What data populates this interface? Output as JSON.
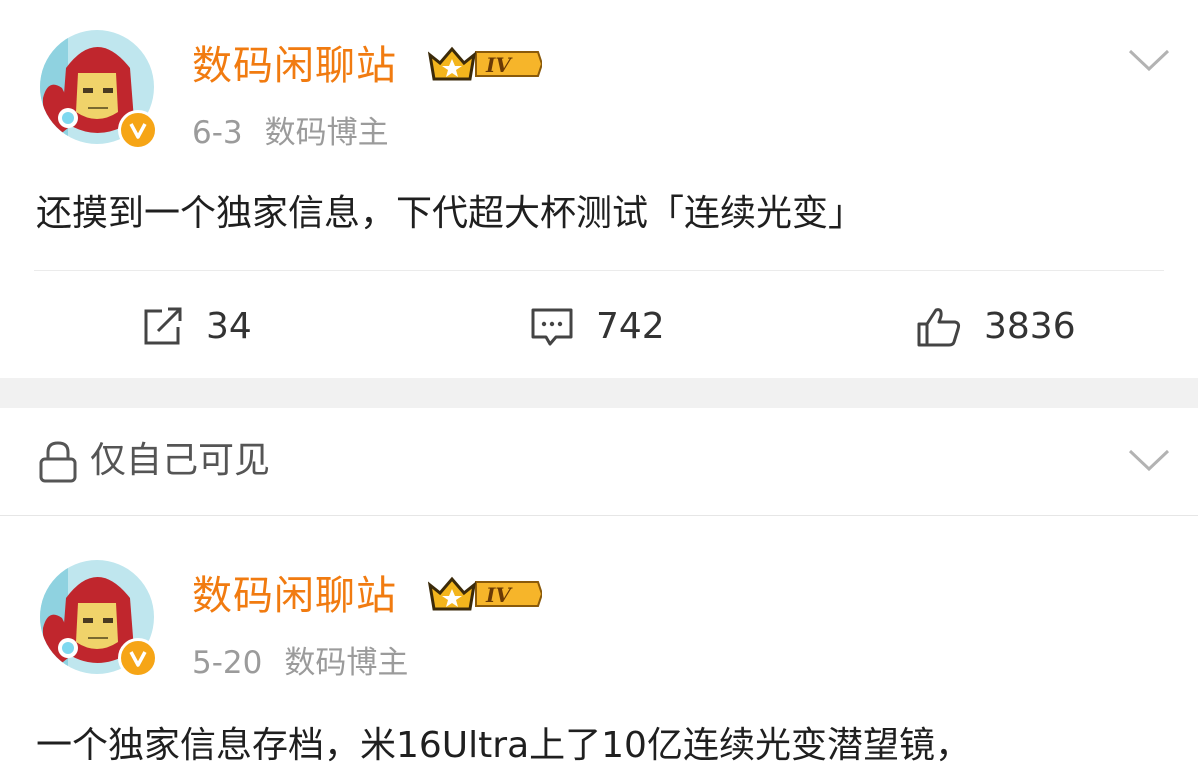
{
  "posts": [
    {
      "author": "数码闲聊站",
      "level_badge": "IV",
      "date": "6-3",
      "role": "数码博主",
      "text": "还摸到一个独家信息，下代超大杯测试「连续光变」",
      "actions": {
        "repost_count": "34",
        "comment_count": "742",
        "like_count": "3836"
      }
    },
    {
      "author": "数码闲聊站",
      "level_badge": "IV",
      "date": "5-20",
      "role": "数码博主",
      "text": "一个独家信息存档，米16Ultra上了10亿连续光变潜望镜，"
    }
  ],
  "private_item": {
    "label": "仅自己可见"
  },
  "icons": {
    "verified": "verified-v-icon",
    "crown": "crown-icon",
    "expand": "chevron-down-icon",
    "repost": "share-icon",
    "comment": "comment-icon",
    "like": "thumbs-up-icon",
    "lock": "lock-icon"
  },
  "colors": {
    "username": "#f17b10",
    "meta": "#9b9b9b",
    "separator": "#f1f1f1",
    "badge": "#f6a516"
  }
}
